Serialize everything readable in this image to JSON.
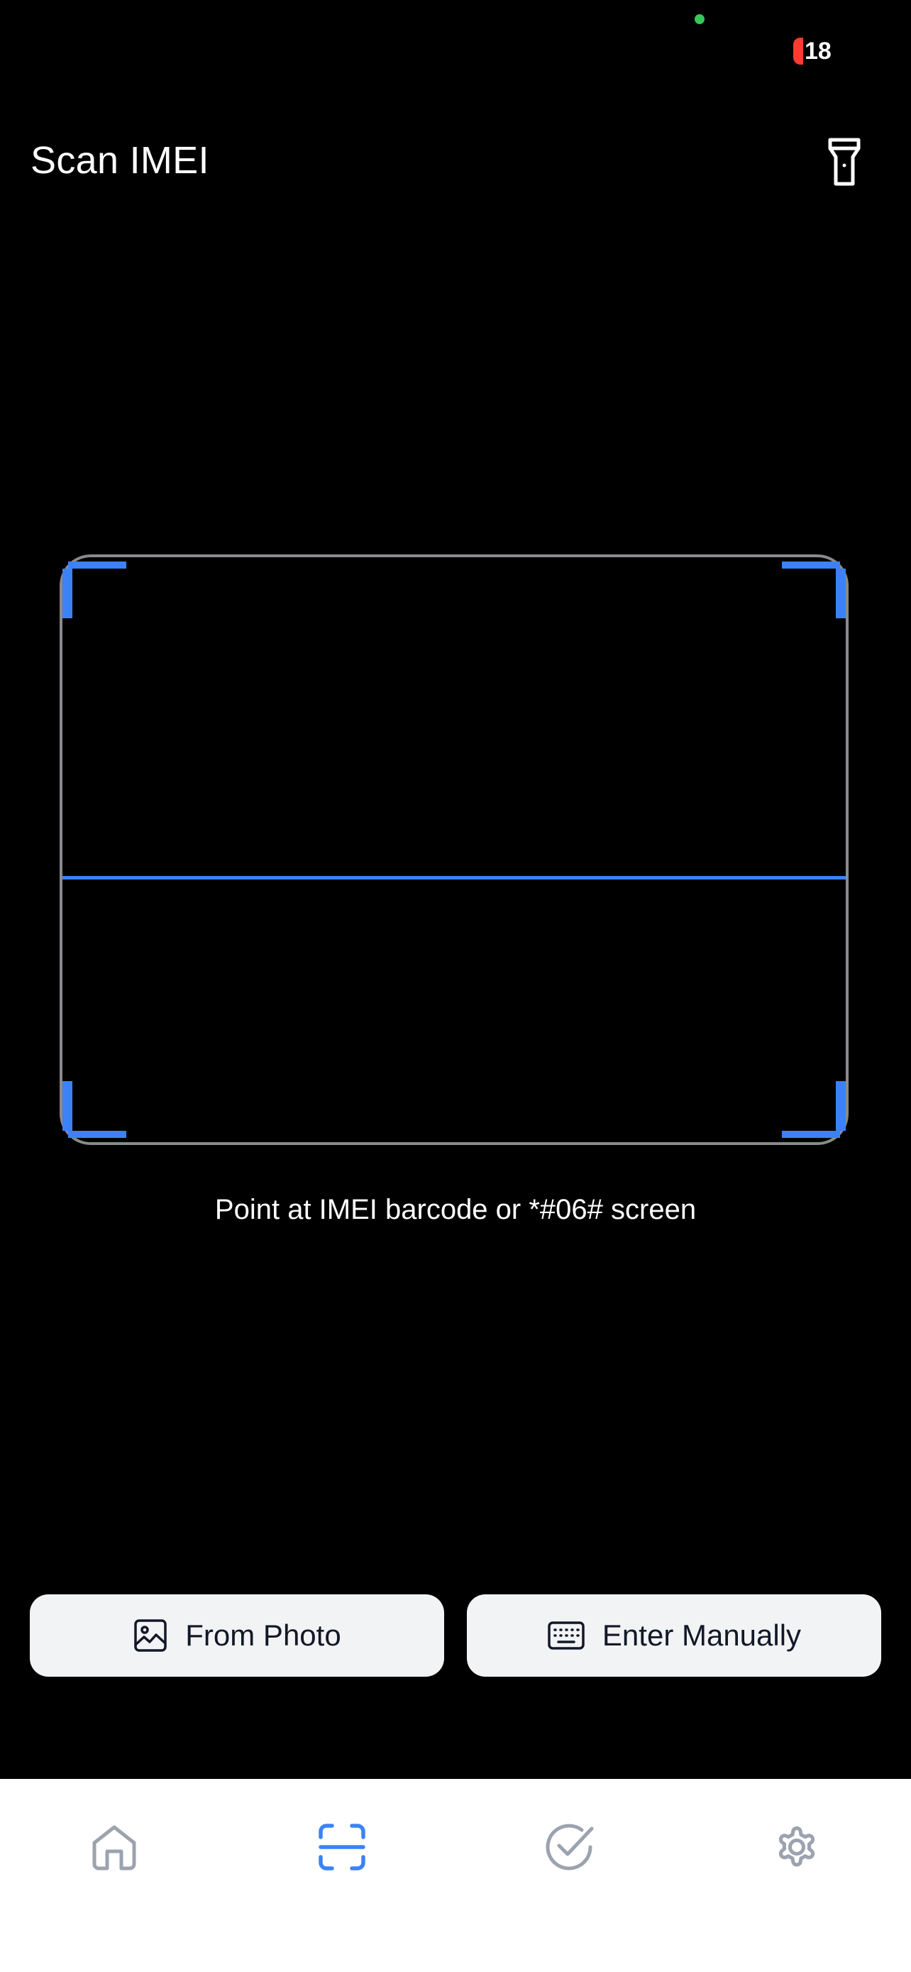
{
  "status_bar": {
    "battery": "18",
    "battery_color": "#ff3b30",
    "indicator_color": "#34c759"
  },
  "header": {
    "title": "Scan IMEI",
    "flashlight_icon": "flashlight-icon"
  },
  "scanner": {
    "hint": "Point at IMEI barcode or *#06# screen",
    "accent_color": "#3b82f6",
    "frame_color": "#8a8a8e"
  },
  "actions": {
    "from_photo": {
      "label": "From Photo",
      "icon": "image-icon"
    },
    "enter_manually": {
      "label": "Enter Manually",
      "icon": "keyboard-icon"
    }
  },
  "tab_bar": {
    "items": [
      {
        "icon": "home-icon",
        "active": false
      },
      {
        "icon": "scan-icon",
        "active": true
      },
      {
        "icon": "check-circle-icon",
        "active": false
      },
      {
        "icon": "gear-icon",
        "active": false
      }
    ],
    "active_color": "#3b82f6",
    "inactive_color": "#9ca3af"
  }
}
